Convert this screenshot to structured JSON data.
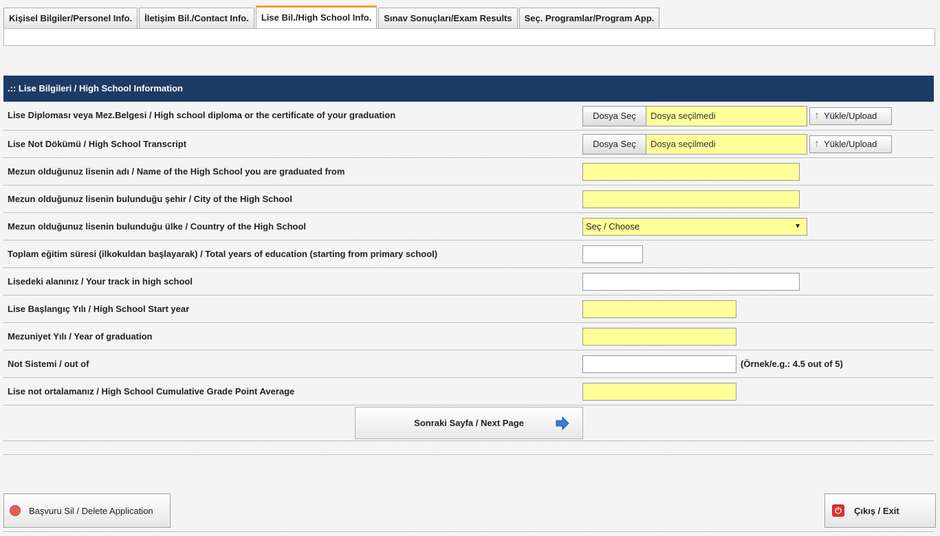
{
  "tabs": [
    {
      "label": "Kişisel Bilgiler/Personel Info.",
      "active": false
    },
    {
      "label": "İletişim Bil./Contact Info.",
      "active": false
    },
    {
      "label": "Lise Bil./High School Info.",
      "active": true
    },
    {
      "label": "Sınav Sonuçları/Exam Results",
      "active": false
    },
    {
      "label": "Seç. Programlar/Program App.",
      "active": false
    }
  ],
  "section": {
    "title": ".:: Lise Bilgileri / High School Information"
  },
  "fields": {
    "diploma": {
      "label": "Lise Diploması veya Mez.Belgesi / High school diploma or the certificate of your graduation",
      "choose_label": "Dosya Seç",
      "file_status": "Dosya seçilmedi",
      "upload_label": "Yükle/Upload"
    },
    "transcript": {
      "label": "Lise Not Dökümü / High School Transcript",
      "choose_label": "Dosya Seç",
      "file_status": "Dosya seçilmedi",
      "upload_label": "Yükle/Upload"
    },
    "school_name": {
      "label": "Mezun olduğunuz lisenin adı / Name of the High School you are graduated from",
      "value": ""
    },
    "school_city": {
      "label": "Mezun olduğunuz lisenin bulunduğu şehir / City of the High School",
      "value": ""
    },
    "school_country": {
      "label": "Mezun olduğunuz lisenin bulunduğu ülke / Country of the High School",
      "selected": "Seç / Choose"
    },
    "total_years": {
      "label": "Toplam eğitim süresi (ilkokuldan başlayarak) / Total years of education (starting from primary school)",
      "value": ""
    },
    "track": {
      "label": "Lisedeki alanınız / Your track in high school",
      "value": ""
    },
    "start_year": {
      "label": "Lise Başlangıç Yılı / High School Start year",
      "value": ""
    },
    "grad_year": {
      "label": "Mezuniyet Yılı / Year of graduation",
      "value": ""
    },
    "grade_system": {
      "label": "Not Sistemi / out of",
      "value": "",
      "hint": "(Örnek/e.g.: 4.5 out of 5)"
    },
    "gpa": {
      "label": "Lise not ortalamanız / High School Cumulative Grade Point Average",
      "value": ""
    }
  },
  "buttons": {
    "next_label": "Sonraki Sayfa / Next Page",
    "delete_label": "Başvuru Sil / Delete Application",
    "exit_label": "Çıkış / Exit"
  },
  "icons": {
    "upload": "upload-arrow-icon",
    "next": "arrow-right-icon",
    "delete": "delete-circle-icon",
    "exit": "power-icon"
  },
  "colors": {
    "header_bg": "#1c3c66",
    "required_field": "#ffff99",
    "active_tab_accent": "#f0a030"
  }
}
